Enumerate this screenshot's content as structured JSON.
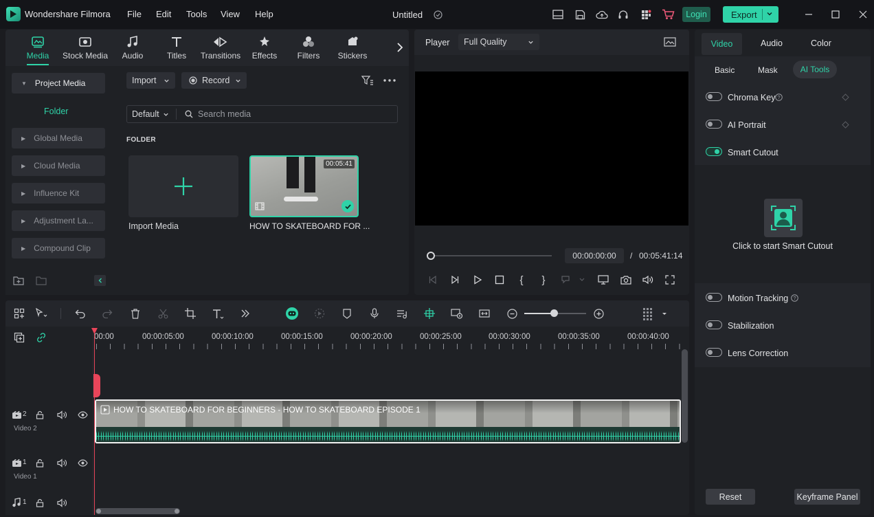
{
  "app": {
    "name": "Wondershare Filmora",
    "project_title": "Untitled"
  },
  "menu": [
    "File",
    "Edit",
    "Tools",
    "View",
    "Help"
  ],
  "account": {
    "login_label": "Login",
    "export_label": "Export"
  },
  "media_tabs": [
    {
      "label": "Media",
      "icon": "media-icon",
      "active": true
    },
    {
      "label": "Stock Media",
      "icon": "stock-media-icon"
    },
    {
      "label": "Audio",
      "icon": "music-note-icon"
    },
    {
      "label": "Titles",
      "icon": "titles-icon"
    },
    {
      "label": "Transitions",
      "icon": "transitions-icon"
    },
    {
      "label": "Effects",
      "icon": "effects-icon"
    },
    {
      "label": "Filters",
      "icon": "filters-icon"
    },
    {
      "label": "Stickers",
      "icon": "stickers-icon"
    }
  ],
  "sidebar": {
    "project_media": "Project Media",
    "folder": "Folder",
    "items": [
      "Global Media",
      "Cloud Media",
      "Influence Kit",
      "Adjustment La...",
      "Compound Clip"
    ]
  },
  "media_toolbar": {
    "import_label": "Import",
    "record_label": "Record",
    "sort_label": "Default",
    "search_placeholder": "Search media"
  },
  "media_section": {
    "heading": "FOLDER",
    "import_tile_label": "Import Media",
    "clip_label": "HOW TO SKATEBOARD FOR ...",
    "clip_duration": "00:05:41"
  },
  "player": {
    "label": "Player",
    "quality": "Full Quality",
    "current_time": "00:00:00:00",
    "separator": "/",
    "total_time": "00:05:41:14"
  },
  "right_panel": {
    "tabs": [
      "Video",
      "Audio",
      "Color"
    ],
    "active_tab": "Video",
    "subtabs": [
      "Basic",
      "Mask",
      "AI Tools"
    ],
    "active_subtab": "AI Tools",
    "options_top": [
      {
        "label": "Chroma Key",
        "on": false
      },
      {
        "label": "AI Portrait",
        "on": false
      },
      {
        "label": "Smart Cutout",
        "on": true
      }
    ],
    "smart_cutout_hint": "Click to start Smart Cutout",
    "options_bottom": [
      {
        "label": "Motion Tracking",
        "on": false
      },
      {
        "label": "Stabilization",
        "on": false
      },
      {
        "label": "Lens Correction",
        "on": false
      }
    ],
    "reset_label": "Reset",
    "keyframe_label": "Keyframe Panel"
  },
  "timeline": {
    "ruler": [
      "00:00",
      "00:00:05:00",
      "00:00:10:00",
      "00:00:15:00",
      "00:00:20:00",
      "00:00:25:00",
      "00:00:30:00",
      "00:00:35:00",
      "00:00:40:00"
    ],
    "tracks": [
      {
        "index": "2",
        "name": "Video 2"
      },
      {
        "index": "1",
        "name": "Video 1"
      },
      {
        "index": "1",
        "name": ""
      }
    ],
    "clip_title": "HOW TO SKATEBOARD FOR BEGINNERS - HOW TO SKATEBOARD EPISODE 1"
  },
  "colors": {
    "accent": "#2fd3a8",
    "login_bg": "#1f5c4c",
    "playhead": "#e8455a"
  }
}
